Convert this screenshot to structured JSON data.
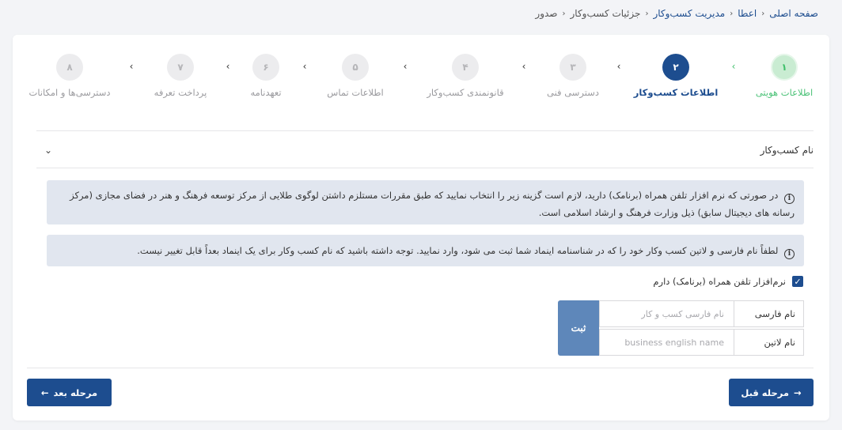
{
  "breadcrumb": {
    "items": [
      "صفحه اصلی",
      "اعطا",
      "مدیریت کسب‌وکار",
      "جزئیات کسب‌وکار",
      "صدور"
    ]
  },
  "stepper": {
    "steps": [
      {
        "number": "۱",
        "label": "اطلاعات هویتی",
        "state": "done"
      },
      {
        "number": "۲",
        "label": "اطلاعات کسب‌وکار",
        "state": "active"
      },
      {
        "number": "۳",
        "label": "دسترسی فنی",
        "state": "pending"
      },
      {
        "number": "۴",
        "label": "قانونمندی کسب‌وکار",
        "state": "pending"
      },
      {
        "number": "۵",
        "label": "اطلاعات تماس",
        "state": "pending"
      },
      {
        "number": "۶",
        "label": "تعهدنامه",
        "state": "pending"
      },
      {
        "number": "۷",
        "label": "پرداخت تعرفه",
        "state": "pending"
      },
      {
        "number": "۸",
        "label": "دسترسی‌ها و امکانات",
        "state": "pending"
      }
    ],
    "arrow_glyph": "›"
  },
  "section": {
    "title": "نام کسب‌وکار",
    "chevron": "chevron-down-icon"
  },
  "info": {
    "icon_glyph": "i",
    "line1": "در صورتی که نرم افزار تلفن همراه (برنامک) دارید، لازم است گزینه زیر را انتخاب نمایید که طبق مقررات مستلزم داشتن لوگوی طلایی از مرکز توسعه فرهنگ و هنر در فضای مجازی (مرکز رسانه های دیجیتال سابق) ذیل وزارت فرهنگ و ارشاد اسلامی است.",
    "line2": "لطفاً نام فارسی و لاتین کسب وکار خود را که در شناسنامه اینماد شما ثبت می شود، وارد نمایید. توجه داشته باشید که نام کسب وکار برای یک اینماد بعداً قابل تغییر نیست."
  },
  "checkbox": {
    "label": "نرم‌افزار تلفن همراه (برنامک) دارم",
    "checked": true,
    "check_glyph": "✓"
  },
  "form": {
    "persian_label": "نام فارسی",
    "persian_placeholder": "نام فارسی کسب و کار",
    "persian_value": "",
    "latin_label": "نام لاتین",
    "latin_placeholder": "business english name",
    "latin_value": "",
    "submit_label": "ثبت"
  },
  "nav": {
    "prev_label": "مرحله قبل",
    "prev_arrow": "→",
    "next_label": "مرحله بعد",
    "next_arrow": "←"
  },
  "colors": {
    "primary": "#1d4d8f",
    "success": "#3fbf6a",
    "info_bg": "#e1e6ef",
    "submit_bg": "#5e87ba"
  }
}
